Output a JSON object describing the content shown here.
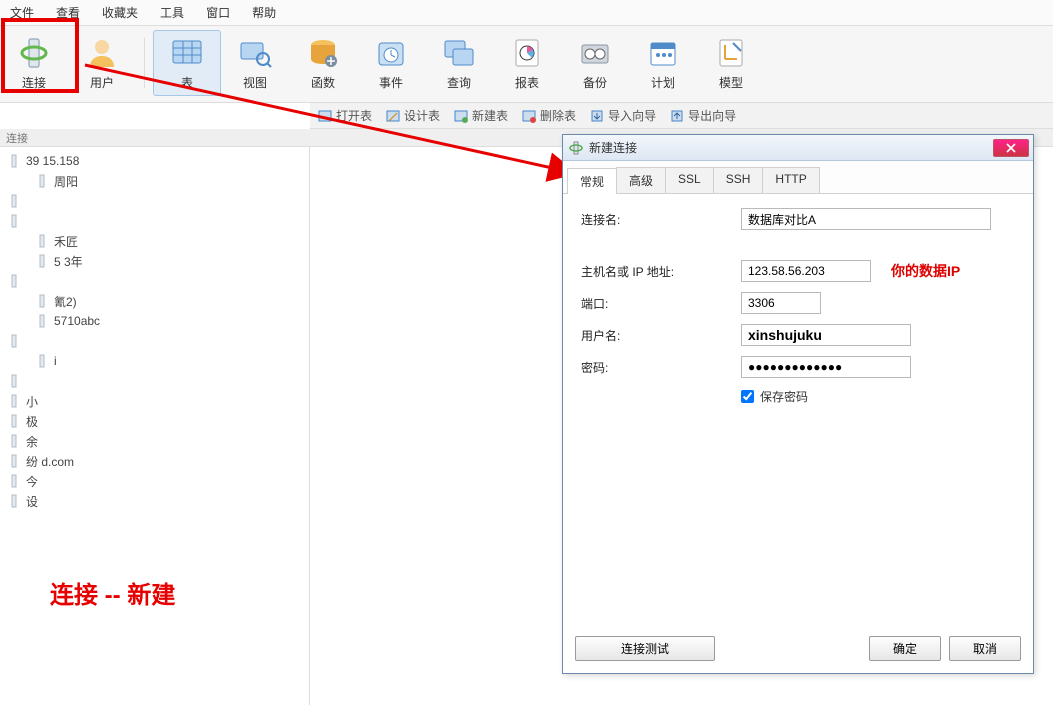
{
  "menu": {
    "file": "文件",
    "view": "查看",
    "fav": "收藏夹",
    "tools": "工具",
    "window": "窗口",
    "help": "帮助"
  },
  "toolbar": {
    "connect": "连接",
    "user": "用户",
    "table": "表",
    "view": "视图",
    "function": "函数",
    "event": "事件",
    "query": "查询",
    "report": "报表",
    "backup": "备份",
    "plan": "计划",
    "model": "模型"
  },
  "thinbar": "连接",
  "actionbar": {
    "open": "打开表",
    "design": "设计表",
    "new": "新建表",
    "delete": "删除表",
    "import": "导入向导",
    "export": "导出向导"
  },
  "tree": [
    {
      "label": "39         15.158",
      "sub": false
    },
    {
      "label": "周阳",
      "sub": true
    },
    {
      "label": "",
      "sub": false
    },
    {
      "label": "",
      "sub": false
    },
    {
      "label": "禾匠",
      "sub": true
    },
    {
      "label": "5 3年",
      "sub": true
    },
    {
      "label": "",
      "sub": false
    },
    {
      "label": "氰2)",
      "sub": true
    },
    {
      "label": "5710abc",
      "sub": true
    },
    {
      "label": "",
      "sub": false
    },
    {
      "label": "i",
      "sub": true
    },
    {
      "label": "",
      "sub": false
    },
    {
      "label": "小",
      "sub": false
    },
    {
      "label": "极",
      "sub": false
    },
    {
      "label": "余",
      "sub": false
    },
    {
      "label": "纷            d.com",
      "sub": false
    },
    {
      "label": "今",
      "sub": false
    },
    {
      "label": "设",
      "sub": false
    }
  ],
  "dialog": {
    "title": "新建连接",
    "tabs": {
      "general": "常规",
      "advanced": "高级",
      "ssl": "SSL",
      "ssh": "SSH",
      "http": "HTTP"
    },
    "labels": {
      "name": "连接名:",
      "host": "主机名或 IP 地址:",
      "port": "端口:",
      "user": "用户名:",
      "pass": "密码:"
    },
    "values": {
      "name": "数据库对比A",
      "host": "123.58.56.203",
      "port": "3306",
      "user": "xinshujuku",
      "pass": "●●●●●●●●●●●●●"
    },
    "annot": "你的数据IP",
    "savepwd": "保存密码",
    "btns": {
      "test": "连接测试",
      "ok": "确定",
      "cancel": "取消"
    }
  },
  "bigred": "连接 -- 新建"
}
